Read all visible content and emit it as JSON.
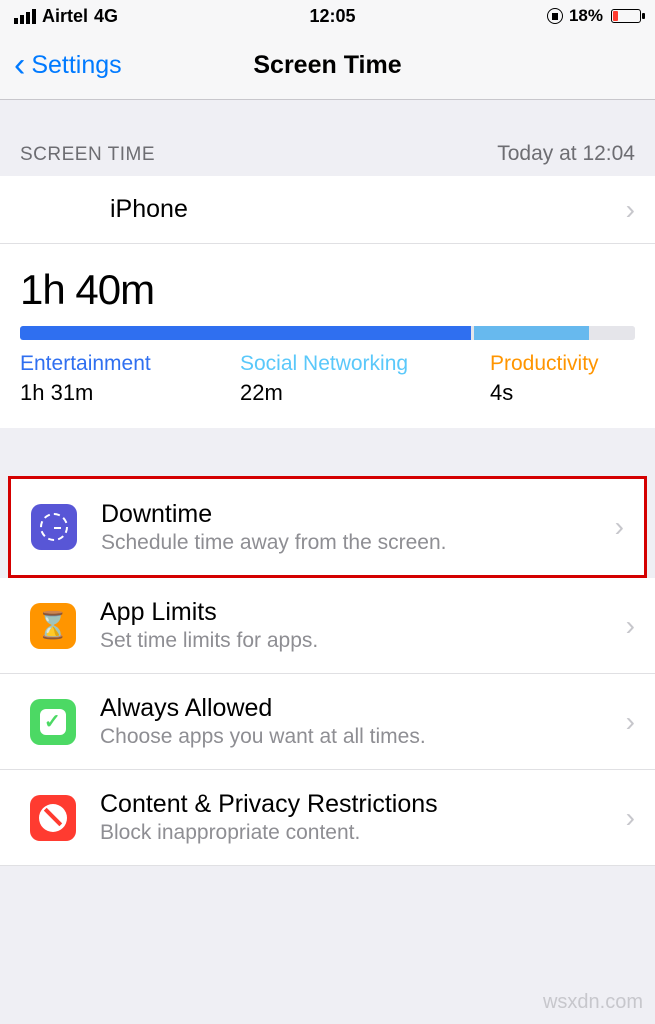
{
  "status_bar": {
    "carrier": "Airtel",
    "network": "4G",
    "time": "12:05",
    "battery_pct": "18%"
  },
  "nav": {
    "back_label": "Settings",
    "title": "Screen Time"
  },
  "section": {
    "header_left": "SCREEN TIME",
    "header_right": "Today at 12:04"
  },
  "device_row": {
    "label": "iPhone"
  },
  "summary": {
    "total_time": "1h 40m",
    "categories": [
      {
        "name": "Entertainment",
        "time": "1h 31m"
      },
      {
        "name": "Social Networking",
        "time": "22m"
      },
      {
        "name": "Productivity",
        "time": "4s"
      }
    ]
  },
  "chart_data": {
    "type": "bar",
    "title": "Screen Time by category",
    "categories": [
      "Entertainment",
      "Social Networking",
      "Productivity"
    ],
    "values_seconds": [
      5460,
      1320,
      4
    ],
    "total_seconds": 6000,
    "colors": [
      "#2f6ff0",
      "#67b9ee",
      "#ff9500"
    ]
  },
  "options": [
    {
      "title": "Downtime",
      "subtitle": "Schedule time away from the screen."
    },
    {
      "title": "App Limits",
      "subtitle": "Set time limits for apps."
    },
    {
      "title": "Always Allowed",
      "subtitle": "Choose apps you want at all times."
    },
    {
      "title": "Content & Privacy Restrictions",
      "subtitle": "Block inappropriate content."
    }
  ],
  "watermark": "wsxdn.com"
}
